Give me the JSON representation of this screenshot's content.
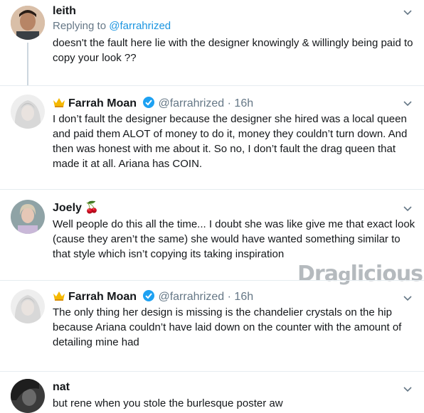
{
  "tweets": [
    {
      "name": "leith",
      "replying_prefix": "Replying to ",
      "replying_handle": "@farrahrized",
      "text": "doesn't the fault here lie with the designer knowingly & willingly being paid to copy your look ??"
    },
    {
      "name": "Farrah Moan",
      "handle": "@farrahrized",
      "time": "· 16h",
      "text": "I don’t fault the designer because the designer she hired was a local queen and paid them ALOT of money to do it, money they couldn’t turn down. And then was honest with me about it. So no, I don’t fault the drag queen that made it at all. Ariana has COIN."
    },
    {
      "name": "Joely",
      "emoji": "🍒",
      "text": "Well people do this all the time... I doubt she was like give me that exact look (cause they aren’t the same) she would have wanted something similar to that style which isn’t copying its taking inspiration"
    },
    {
      "name": "Farrah Moan",
      "handle": "@farrahrized",
      "time": "· 16h",
      "text": "The only thing her design is missing is the chandelier crystals on the hip because Ariana couldn’t have laid down on the counter with the amount of detailing mine had"
    },
    {
      "name": "nat",
      "text": "but rene when you stole the burlesque poster aw"
    }
  ],
  "watermark": "Draglicious",
  "colors": {
    "text": "#14171a",
    "secondary": "#657786",
    "link": "#1b95e0",
    "verified": "#1da1f2",
    "thread_line": "#cdd7df"
  }
}
